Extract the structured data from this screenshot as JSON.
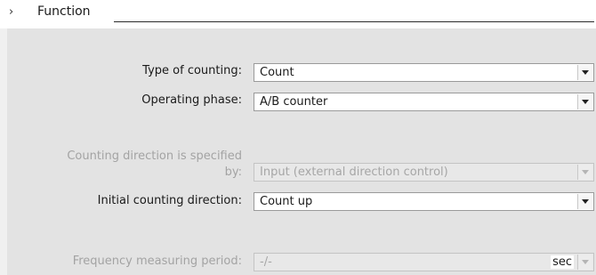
{
  "section": {
    "title": "Function"
  },
  "fields": {
    "type_of_counting": {
      "label": "Type of counting:",
      "value": "Count"
    },
    "operating_phase": {
      "label": "Operating phase:",
      "value": "A/B counter"
    },
    "counting_direction_specified_by": {
      "label_line1": "Counting direction is specified",
      "label_line2": "by:",
      "value": "Input (external direction control)"
    },
    "initial_counting_direction": {
      "label": "Initial counting direction:",
      "value": "Count up"
    },
    "frequency_measuring_period": {
      "label": "Frequency measuring period:",
      "value": "-/-",
      "unit": "sec"
    }
  }
}
